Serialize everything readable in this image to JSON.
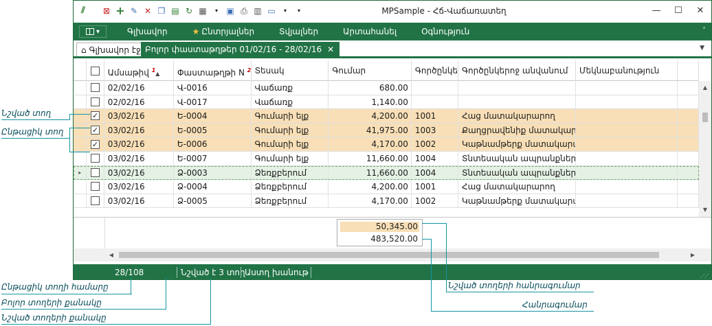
{
  "window": {
    "title": "MPSample - Հճ-Վաճառատեղ",
    "controls": {
      "minimize": "—",
      "maximize": "☐",
      "close": "✕"
    }
  },
  "ribbon": {
    "menu_button": "▾",
    "tabs": [
      "Գլխավոր",
      "Ընտրյալներ",
      "Տվյալներ",
      "Արտահանել",
      "Օգնություն"
    ],
    "collapse": "˄"
  },
  "doc_tabs": {
    "home": "Գլխավոր էջ",
    "active": "Բոլոր փաստաթղթեր 01/02/16 - 28/02/16",
    "close": "✕",
    "dropdown": "▼"
  },
  "grid": {
    "columns": [
      {
        "label": "Ամսաթիվ",
        "sort_index": "1",
        "sort": "▲"
      },
      {
        "label": "Փաստաթղթի N",
        "sort_index": "2",
        "sort": "▲"
      },
      {
        "label": "Տեսակ"
      },
      {
        "label": "Գումար"
      },
      {
        "label": "Գործընկեր"
      },
      {
        "label": "Գործընկերոջ անվանում"
      },
      {
        "label": "Մեկնաբանություն"
      }
    ],
    "rows": [
      {
        "date": "02/02/16",
        "doc": "Վ-0016",
        "type": "Վաճառք",
        "sum": "680.00",
        "partner": "",
        "pname": "",
        "checked": false,
        "focused": false
      },
      {
        "date": "02/02/16",
        "doc": "Վ-0017",
        "type": "Վաճառք",
        "sum": "1,140.00",
        "partner": "",
        "pname": "",
        "checked": false,
        "focused": false
      },
      {
        "date": "03/02/16",
        "doc": "Ե-0004",
        "type": "Գումարի ելք",
        "sum": "4,200.00",
        "partner": "1001",
        "pname": "Հաց մատակարարող",
        "checked": true,
        "focused": false
      },
      {
        "date": "03/02/16",
        "doc": "Ե-0005",
        "type": "Գումարի ելք",
        "sum": "41,975.00",
        "partner": "1003",
        "pname": "Քաղցրավենիք մատակար...",
        "checked": true,
        "focused": false
      },
      {
        "date": "03/02/16",
        "doc": "Ե-0006",
        "type": "Գումարի ելք",
        "sum": "4,170.00",
        "partner": "1002",
        "pname": "Կաթնամթերք մատակարա...",
        "checked": true,
        "focused": false
      },
      {
        "date": "03/02/16",
        "doc": "Ե-0007",
        "type": "Գումարի ելք",
        "sum": "11,660.00",
        "partner": "1004",
        "pname": "Տնտեսական ապրանքներ...",
        "checked": false,
        "focused": false
      },
      {
        "date": "03/02/16",
        "doc": "Ձ-0003",
        "type": "Ձեռքբերում",
        "sum": "11,660.00",
        "partner": "1004",
        "pname": "Տնտեսական ապրանքներ...",
        "checked": false,
        "focused": true
      },
      {
        "date": "03/02/16",
        "doc": "Ձ-0004",
        "type": "Ձեռքբերում",
        "sum": "4,200.00",
        "partner": "1001",
        "pname": "Հաց մատակարարող",
        "checked": false,
        "focused": false
      },
      {
        "date": "03/02/16",
        "doc": "Ձ-0005",
        "type": "Ձեռքբերում",
        "sum": "4,170.00",
        "partner": "1002",
        "pname": "Կաթնամթերք մատակարա...",
        "checked": false,
        "focused": false
      }
    ],
    "totals": {
      "selected": "50,345.00",
      "all": "483,520.00"
    }
  },
  "status": {
    "position": "28/108",
    "selected": "Նշված է 3 տող",
    "filter": "Աստղ խանութ"
  },
  "callouts": {
    "marked_row": "Նշված տող",
    "current_row": "Ընթացիկ տող",
    "current_row_number": "Ընթացիկ տողի համարը",
    "all_rows_count": "Բոլոր տողերի քանակը",
    "marked_rows_count": "Նշված տողերի քանակը",
    "marked_rows_total": "Նշված տողերի հանրագումար",
    "total": "Հանրագումար"
  },
  "colors": {
    "accent": "#217346",
    "checked_row": "#f8dfb7",
    "focused_row": "#e5f1e5",
    "callout": "#1594a0"
  }
}
